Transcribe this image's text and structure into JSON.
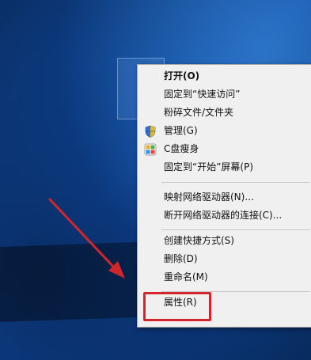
{
  "menu": {
    "items": [
      {
        "label": "打开(O)",
        "bold": true
      },
      {
        "label": "固定到“快速访问”"
      },
      {
        "label": "粉碎文件/文件夹"
      },
      {
        "label": "管理(G)",
        "icon": "shield-icon"
      },
      {
        "label": "C盘瘦身",
        "icon": "cleanup-app-icon"
      },
      {
        "label": "固定到“开始”屏幕(P)"
      },
      {
        "label": "映射网络驱动器(N)..."
      },
      {
        "label": "断开网络驱动器的连接(C)..."
      },
      {
        "label": "创建快捷方式(S)"
      },
      {
        "label": "删除(D)"
      },
      {
        "label": "重命名(M)"
      },
      {
        "label": "属性(R)"
      }
    ]
  },
  "colors": {
    "annotation_red": "#d1262b",
    "menu_bg": "#f0f0f0",
    "desktop_blue": "#0c4aa2"
  }
}
